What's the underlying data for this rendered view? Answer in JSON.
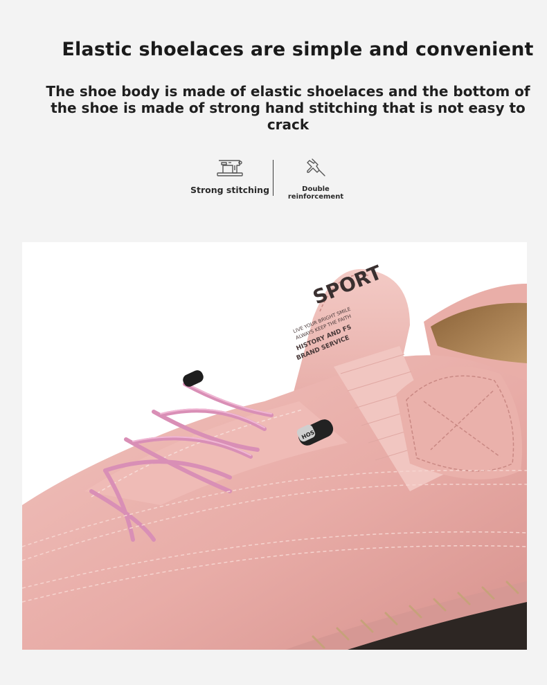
{
  "headline": "Elastic shoelaces are simple and convenient",
  "subline": "The shoe body is made of elastic shoelaces and the bottom of the shoe is made of strong hand stitching that is not easy to crack",
  "features": [
    {
      "icon": "sewing-machine-icon",
      "label": "Strong stitching"
    },
    {
      "icon": "pushpin-icon",
      "label": "Double reinforcement"
    }
  ],
  "product": {
    "brand_text": "SPORT",
    "lace_lock_text": "HOS",
    "colors": {
      "leather": "#eab1ac",
      "leather_shadow": "#d9938f",
      "lace": "#d98fb6",
      "sole": "#2d2623",
      "lining": "#b48a57"
    }
  }
}
